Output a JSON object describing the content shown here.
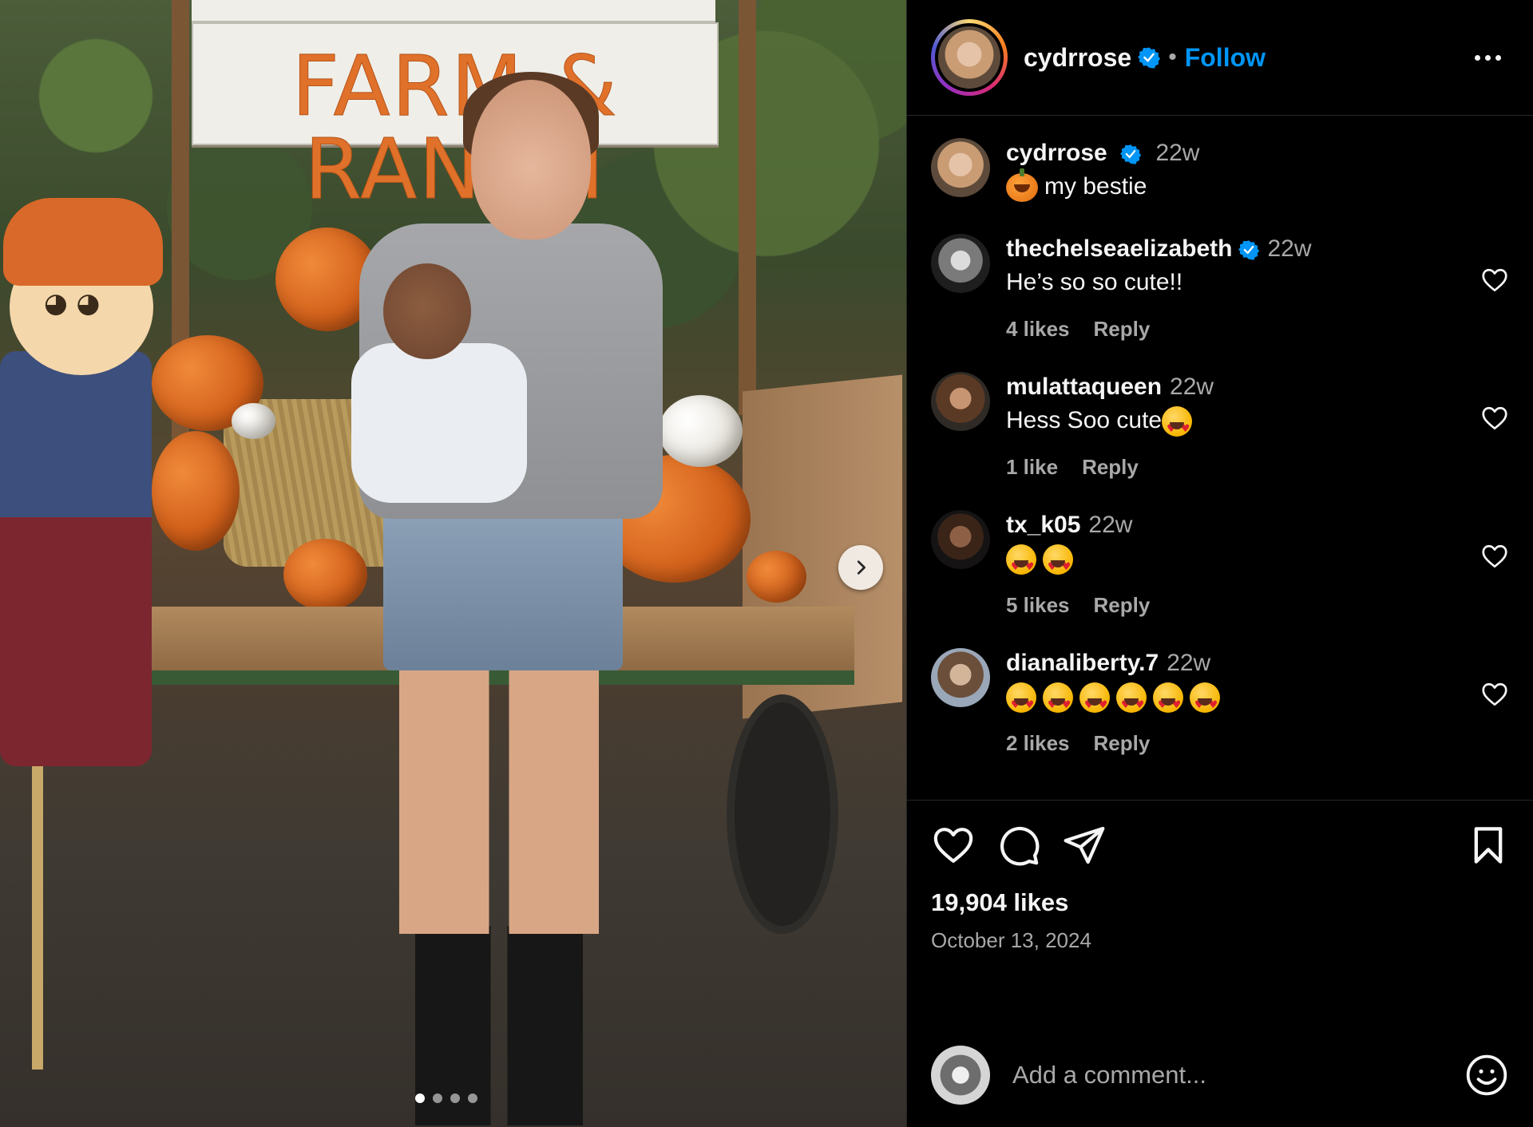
{
  "photo": {
    "sign_text": "FARM & RANCH",
    "carousel_dots": [
      true,
      false,
      false,
      false
    ]
  },
  "header": {
    "username": "cydrrose",
    "separator": "•",
    "follow_label": "Follow"
  },
  "caption": {
    "username": "cydrrose",
    "time": "22w",
    "text": "my bestie"
  },
  "comments": [
    {
      "username": "thechelseaelizabeth",
      "verified": true,
      "time": "22w",
      "text": "He’s so so cute!!",
      "emoji_count": 0,
      "likes": "4 likes",
      "reply": "Reply"
    },
    {
      "username": "mulattaqueen",
      "verified": false,
      "time": "22w",
      "text": "Hess Soo cute",
      "emoji_count": 1,
      "likes": "1 like",
      "reply": "Reply"
    },
    {
      "username": "tx_k05",
      "verified": false,
      "time": "22w",
      "text": "",
      "emoji_count": 2,
      "likes": "5 likes",
      "reply": "Reply"
    },
    {
      "username": "dianaliberty.7",
      "verified": false,
      "time": "22w",
      "text": "",
      "emoji_count": 6,
      "likes": "2 likes",
      "reply": "Reply"
    }
  ],
  "actions": {
    "likes": "19,904 likes",
    "date": "October 13, 2024"
  },
  "add_comment": {
    "placeholder": "Add a comment..."
  },
  "colors": {
    "accent": "#0095f6",
    "secondary_text": "#a8a8a8",
    "background": "#000000"
  },
  "icons": [
    "verified-badge-icon",
    "more-options-icon",
    "heart-icon",
    "comment-icon",
    "share-icon",
    "bookmark-icon",
    "emoji-icon",
    "chevron-right-icon"
  ]
}
